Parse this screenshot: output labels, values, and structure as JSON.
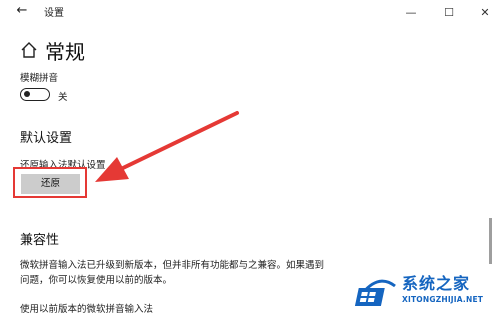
{
  "window": {
    "title": "设置",
    "back_glyph": "←",
    "minimize_glyph": "—",
    "maximize_glyph": "☐",
    "close_glyph": "✕"
  },
  "page": {
    "title": "常规",
    "fuzzy_pinyin": {
      "label": "模糊拼音",
      "state_label": "关"
    },
    "default_section": {
      "title": "默认设置",
      "restore_label": "还原输入法默认设置",
      "restore_button": "还原"
    },
    "compat_section": {
      "title": "兼容性",
      "description": "微软拼音输入法已升级到新版本，但并非所有功能都与之兼容。如果遇到问题，你可以恢复使用以前的版本。",
      "prev_version_label": "使用以前版本的微软拼音输入法"
    }
  },
  "watermark": {
    "name": "系统之家",
    "url": "XITONGZHIJIA.NET"
  },
  "colors": {
    "annotation_red": "#e53935",
    "button_gray": "#cccccc",
    "watermark_blue": "#1565c0"
  },
  "icons": [
    "back-arrow-icon",
    "home-icon",
    "minimize-icon",
    "maximize-icon",
    "close-icon",
    "toggle-switch"
  ]
}
